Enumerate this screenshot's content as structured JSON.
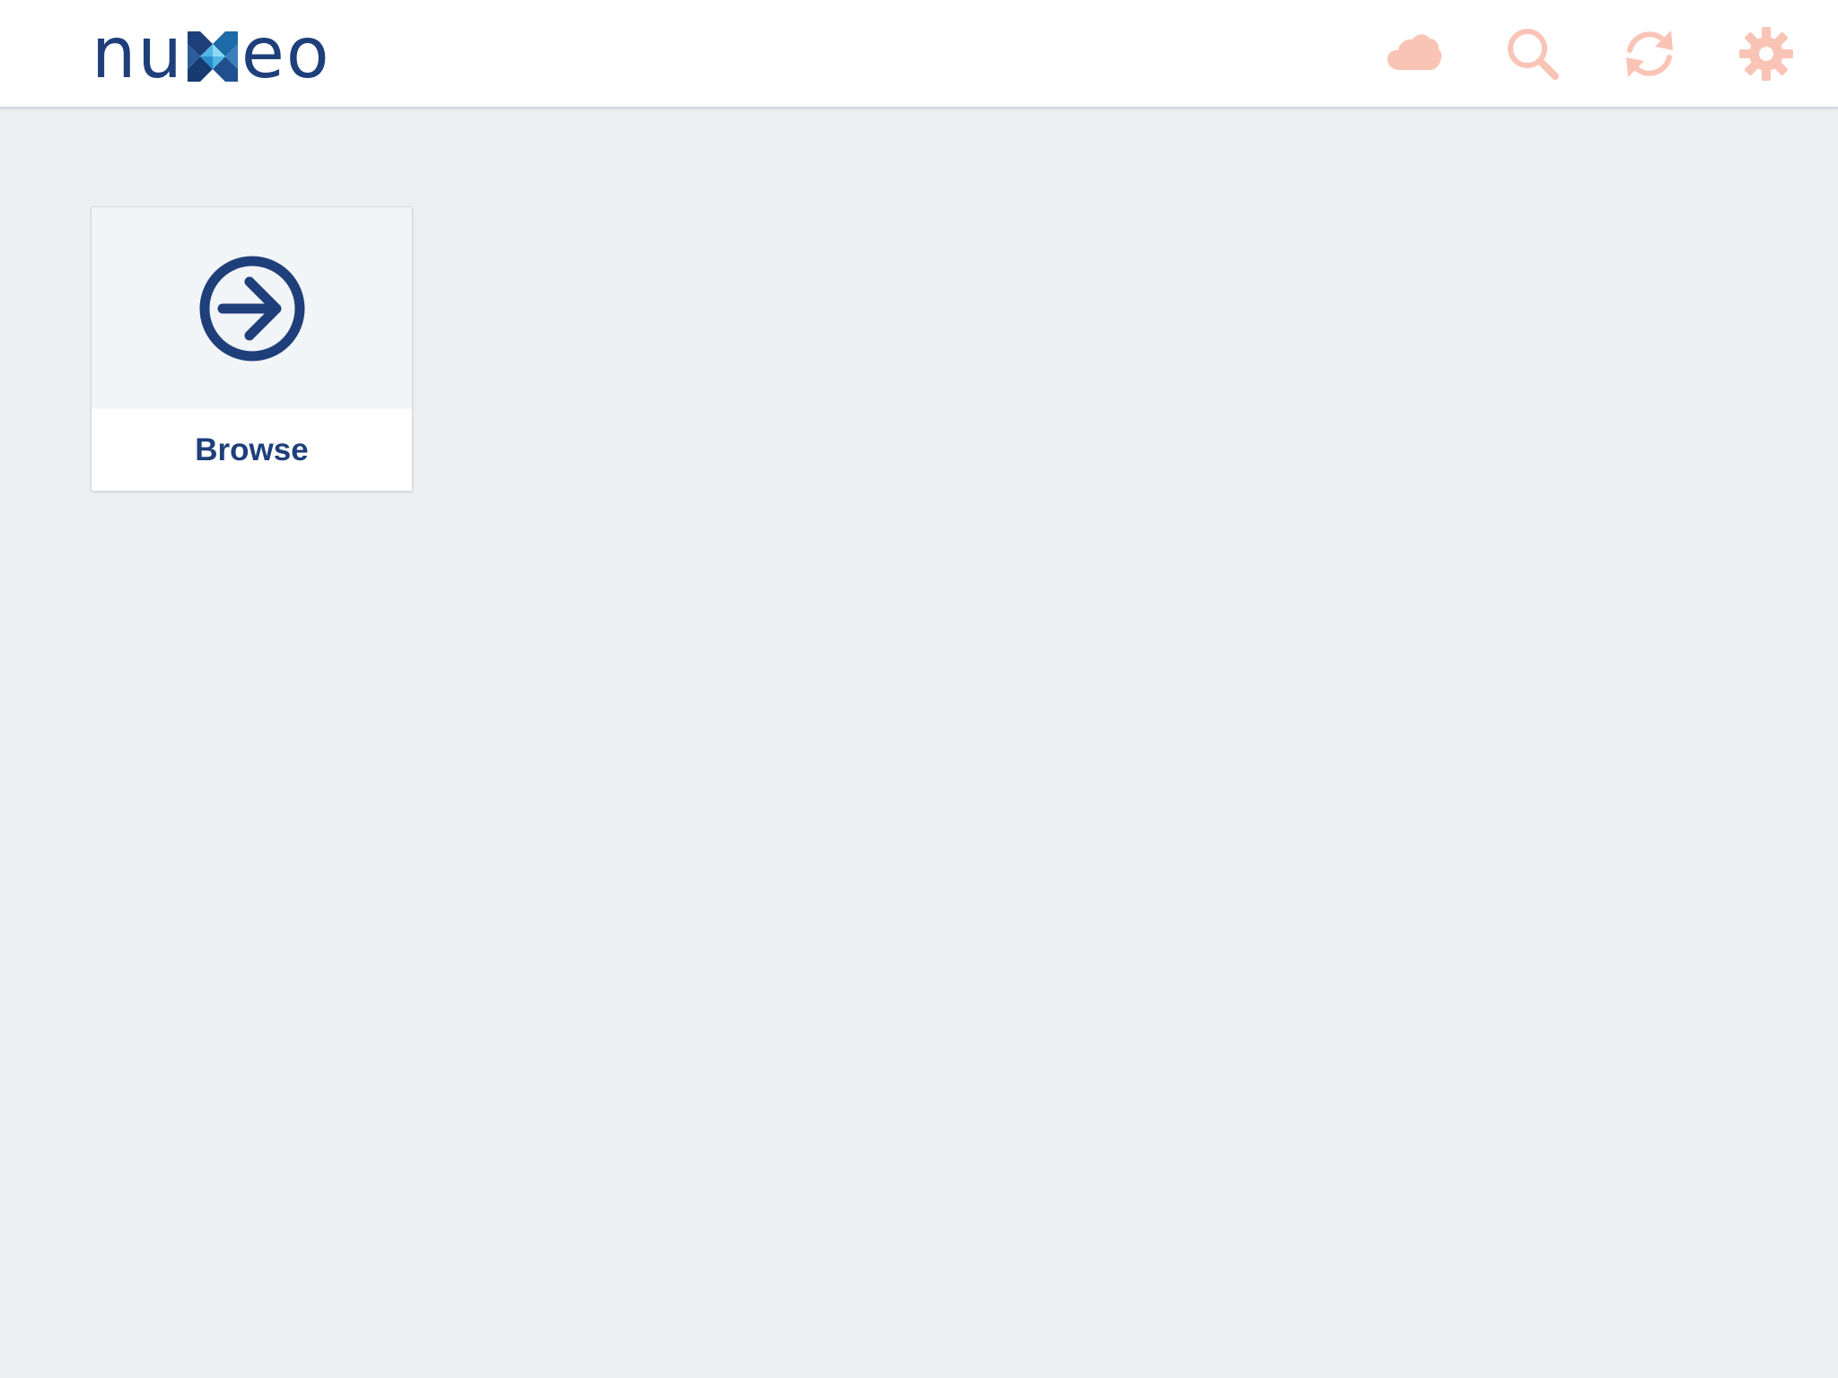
{
  "header": {
    "logo": {
      "text_before": "nu",
      "text_after": "eo",
      "mark": "x-mark-logo"
    },
    "toolbar": [
      {
        "name": "cloud-icon",
        "icon": "cloud"
      },
      {
        "name": "search-icon",
        "icon": "magnifier"
      },
      {
        "name": "sync-icon",
        "icon": "refresh-arrows"
      },
      {
        "name": "gear-icon",
        "icon": "gear"
      }
    ]
  },
  "tiles": [
    {
      "label": "Browse",
      "icon": "arrow-circle-right-icon"
    }
  ],
  "colors": {
    "brand_blue": "#1e3f7a",
    "toolbar_icon": "#f9c4b6",
    "background": "#eeeff1",
    "tile_top": "#f2f5f7"
  }
}
